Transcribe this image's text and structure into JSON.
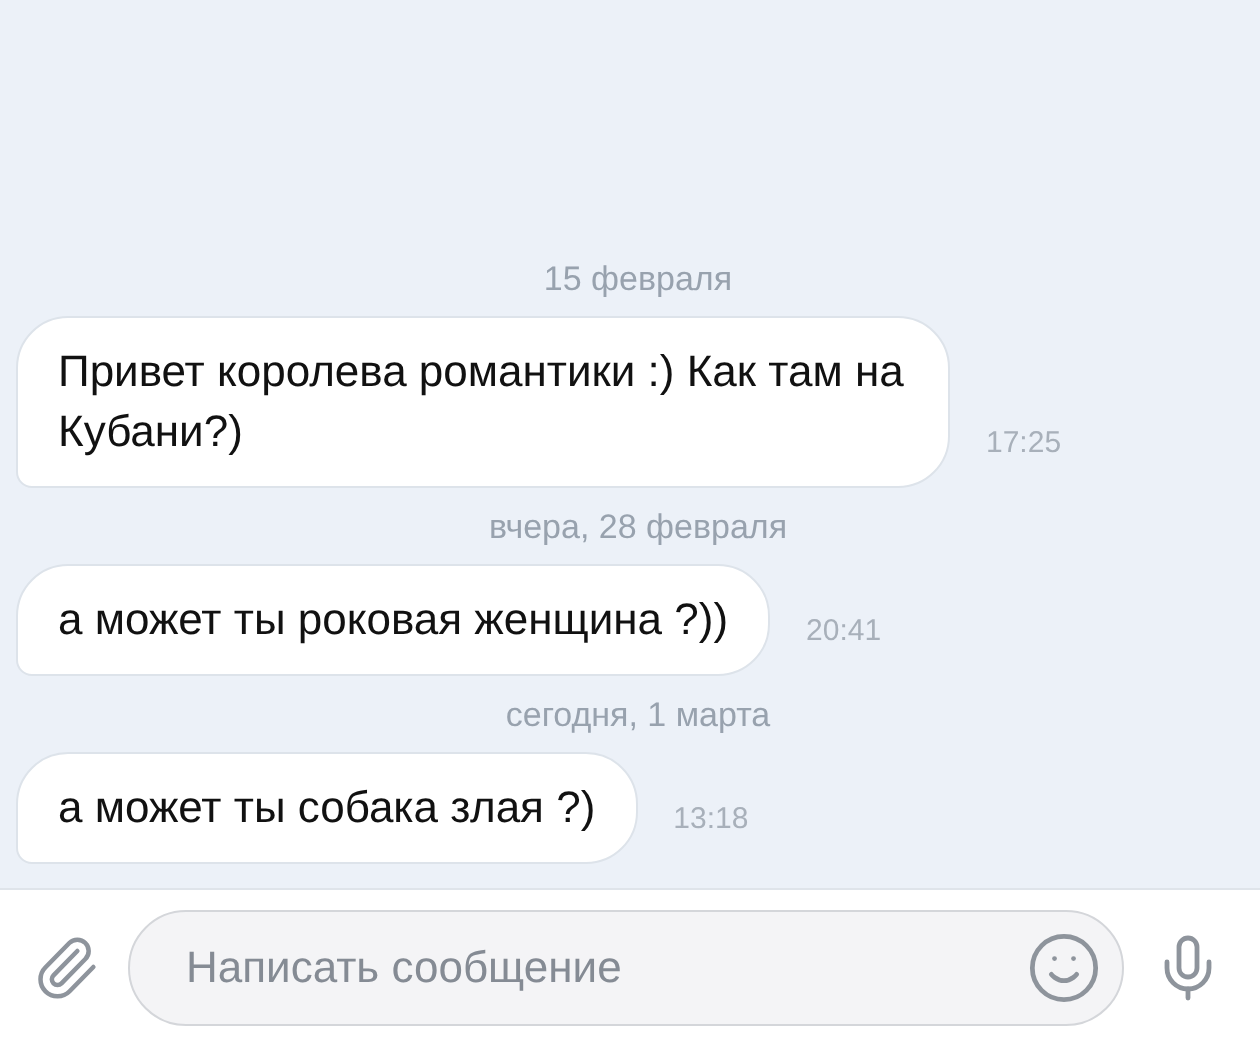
{
  "messages": [
    {
      "kind": "date",
      "text": "15 февраля"
    },
    {
      "kind": "message",
      "text": "Привет королева романтики :) Как там на Кубани?)",
      "time": "17:25"
    },
    {
      "kind": "date",
      "text": "вчера, 28 февраля"
    },
    {
      "kind": "message",
      "text": "а может ты роковая женщина ?))",
      "time": "20:41"
    },
    {
      "kind": "date",
      "text": "сегодня, 1 марта"
    },
    {
      "kind": "message",
      "text": "а может ты собака злая ?)",
      "time": "13:18"
    }
  ],
  "composer": {
    "placeholder": "Написать сообщение"
  }
}
